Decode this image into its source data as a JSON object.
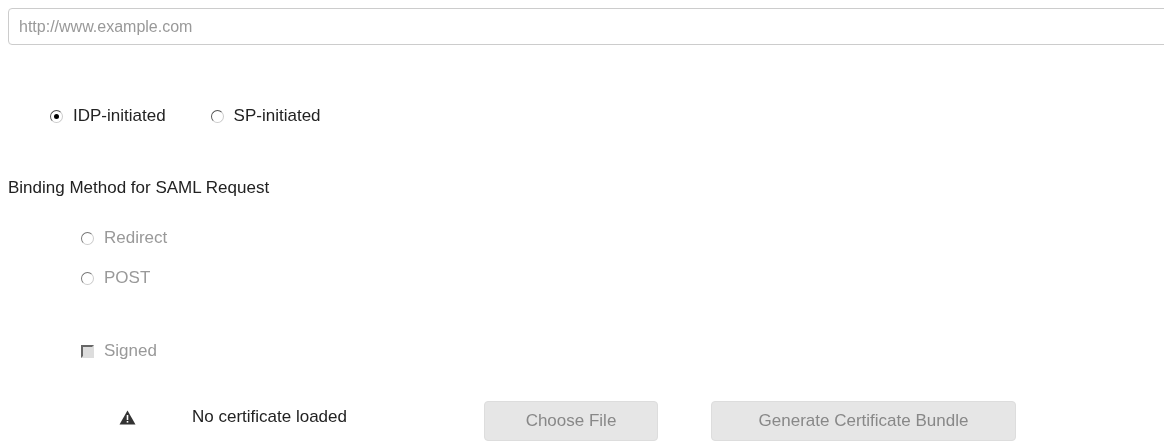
{
  "url_field": {
    "placeholder": "http://www.example.com"
  },
  "initiation": [
    {
      "label": "IDP-initiated",
      "selected": true
    },
    {
      "label": "SP-initiated",
      "selected": false
    }
  ],
  "binding_heading": "Binding Method for SAML Request",
  "binding": [
    {
      "label": "Redirect",
      "selected": false,
      "disabled": true
    },
    {
      "label": "POST",
      "selected": false,
      "disabled": true
    }
  ],
  "signed": {
    "label": "Signed",
    "checked": false,
    "disabled": true
  },
  "certificate": {
    "status": "No certificate loaded"
  },
  "buttons": [
    {
      "label": "Choose File",
      "disabled": true
    },
    {
      "label": "Generate Certificate Bundle",
      "disabled": true
    }
  ]
}
